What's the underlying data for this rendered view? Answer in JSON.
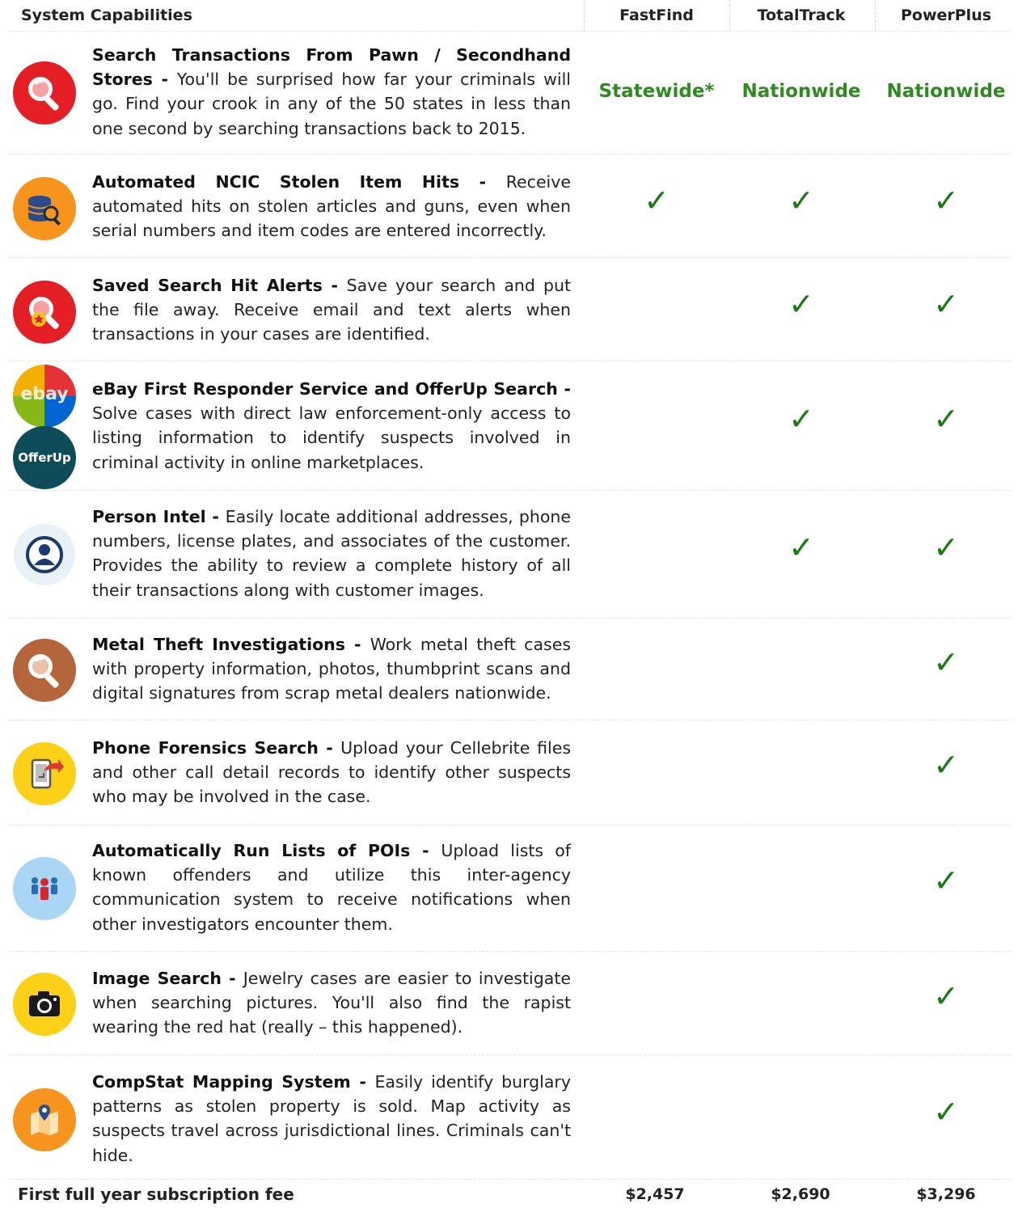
{
  "header": {
    "capabilities_label": "System Capabilities",
    "columns": [
      "FastFind",
      "TotalTrack",
      "PowerPlus"
    ]
  },
  "colors": {
    "check": "#1a7a12",
    "reach_text": "#2e8b1f"
  },
  "rows": [
    {
      "icon": "magnifier-icon",
      "title": "Search Transactions From Pawn / Secondhand Stores",
      "text": "You'll be surprised how far your criminals will go. Find your crook in any of the 50 states in less than one second by searching transactions back to 2015.",
      "fastfind": "Statewide*",
      "totaltrack": "Nationwide",
      "powerplus": "Nationwide"
    },
    {
      "icon": "database-search-icon",
      "title": "Automated NCIC Stolen Item Hits",
      "text": "Receive automated hits on stolen articles and guns, even when serial numbers and item codes are entered incorrectly.",
      "fastfind": "✓",
      "totaltrack": "✓",
      "powerplus": "✓"
    },
    {
      "icon": "alert-search-icon",
      "title": "Saved Search Hit Alerts",
      "text": "Save your search and put the file away. Receive email and text alerts when transactions in your cases are identified.",
      "fastfind": "",
      "totaltrack": "✓",
      "powerplus": "✓"
    },
    {
      "icon": "ebay-offerup-icon",
      "icon_text_top": "ebay",
      "icon_text_bottom": "OfferUp",
      "title": "eBay First Responder Service and OfferUp Search",
      "text": "Solve cases with direct law enforcement-only access to listing information to identify suspects involved in criminal activity in online marketplaces.",
      "fastfind": "",
      "totaltrack": "✓",
      "powerplus": "✓"
    },
    {
      "icon": "person-icon",
      "title": "Person Intel",
      "text": "Easily locate additional addresses, phone numbers, license plates, and associates of the customer. Provides the ability to review a complete history of all their transactions along with customer images.",
      "fastfind": "",
      "totaltrack": "✓",
      "powerplus": "✓"
    },
    {
      "icon": "metal-search-icon",
      "title": "Metal Theft Investigations",
      "text": "Work metal theft cases with property information, photos, thumbprint scans and digital signatures from scrap metal dealers nationwide.",
      "fastfind": "",
      "totaltrack": "",
      "powerplus": "✓"
    },
    {
      "icon": "phone-forensics-icon",
      "title": "Phone Forensics Search",
      "text": "Upload your Cellebrite files and other call detail records to identify other suspects who may be involved in the case.",
      "fastfind": "",
      "totaltrack": "",
      "powerplus": "✓"
    },
    {
      "icon": "group-icon",
      "title": "Automatically Run Lists of POIs",
      "text": "Upload lists of known offenders and utilize this inter-agency communication system to receive notifications when other investigators encounter them.",
      "fastfind": "",
      "totaltrack": "",
      "powerplus": "✓"
    },
    {
      "icon": "camera-icon",
      "title": "Image Search",
      "text": "Jewelry cases are easier to investigate when searching pictures. You'll also find the rapist wearing the red hat (really – this happened).",
      "fastfind": "",
      "totaltrack": "",
      "powerplus": "✓"
    },
    {
      "icon": "map-pin-icon",
      "title": "CompStat Mapping System",
      "text": "Easily identify burglary patterns as stolen property is sold. Map activity as suspects travel across jurisdictional lines. Criminals can't hide.",
      "fastfind": "",
      "totaltrack": "",
      "powerplus": "✓"
    }
  ],
  "footer": {
    "label": "First full year subscription fee",
    "prices": [
      "$2,457",
      "$2,690",
      "$3,296"
    ]
  }
}
